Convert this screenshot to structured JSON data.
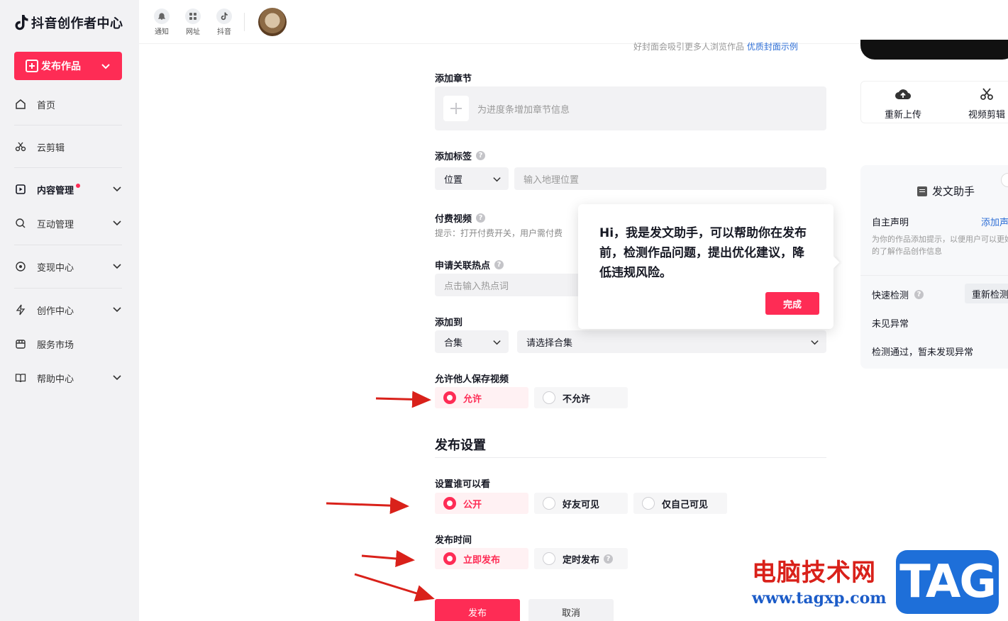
{
  "brand": {
    "name": "抖音创作者中心"
  },
  "sidebar": {
    "publish_label": "发布作品",
    "items": [
      {
        "label": "首页",
        "icon": "home-icon"
      },
      {
        "label": "云剪辑",
        "icon": "scissors-icon"
      },
      {
        "label": "内容管理",
        "icon": "play-square-icon"
      },
      {
        "label": "互动管理",
        "icon": "chat-search-icon"
      },
      {
        "label": "变现中心",
        "icon": "coin-icon"
      },
      {
        "label": "创作中心",
        "icon": "bolt-icon"
      },
      {
        "label": "服务市场",
        "icon": "store-icon"
      },
      {
        "label": "帮助中心",
        "icon": "book-icon"
      }
    ]
  },
  "topbar": {
    "notify": "通知",
    "url": "网址",
    "douyin": "抖音"
  },
  "form": {
    "cover_hint": "好封面会吸引更多人浏览作品",
    "cover_link": "优质封面示例",
    "chapter_label": "添加章节",
    "chapter_placeholder": "为进度条增加章节信息",
    "tag_label": "添加标签",
    "tag_select": "位置",
    "location_placeholder": "输入地理位置",
    "paid_label": "付费视频",
    "paid_tip": "提示：打开付费开关，用户需付费",
    "hot_label": "申请关联热点",
    "hot_placeholder": "点击输入热点词",
    "addto_label": "添加到",
    "addto_select": "合集",
    "collection_placeholder": "请选择合集",
    "save_label": "允许他人保存视频",
    "save_allow": "允许",
    "save_deny": "不允许",
    "publish_section": "发布设置",
    "visibility_label": "设置谁可以看",
    "vis_public": "公开",
    "vis_friends": "好友可见",
    "vis_private": "仅自己可见",
    "time_label": "发布时间",
    "time_now": "立即发布",
    "time_scheduled": "定时发布",
    "publish_btn": "发布",
    "cancel_btn": "取消",
    "help_mark": "?"
  },
  "popover": {
    "text": "Hi，我是发文助手，可以帮助你在发布前，检测作品问题，提出优化建议，降低违规风险。",
    "done": "完成"
  },
  "right": {
    "reupload": "重新上传",
    "edit_video": "视频剪辑",
    "assistant_title": "发文助手",
    "self_declare": "自主声明",
    "add_declare": "添加声明",
    "declare_desc": "为你的作品添加提示，以便用户可以更好的了解作品创作信息",
    "quick_check": "快速检测",
    "recheck": "重新检测",
    "no_issue": "未见异常",
    "check_pass": "检测通过，暂未发现异常"
  },
  "watermark": {
    "site_name": "电脑技术网",
    "site_url": "www.tagxp.com",
    "tag": "TAG"
  },
  "colors": {
    "accent": "#fe2c55",
    "arrow": "#d9211a",
    "link": "#2f6fd6"
  }
}
